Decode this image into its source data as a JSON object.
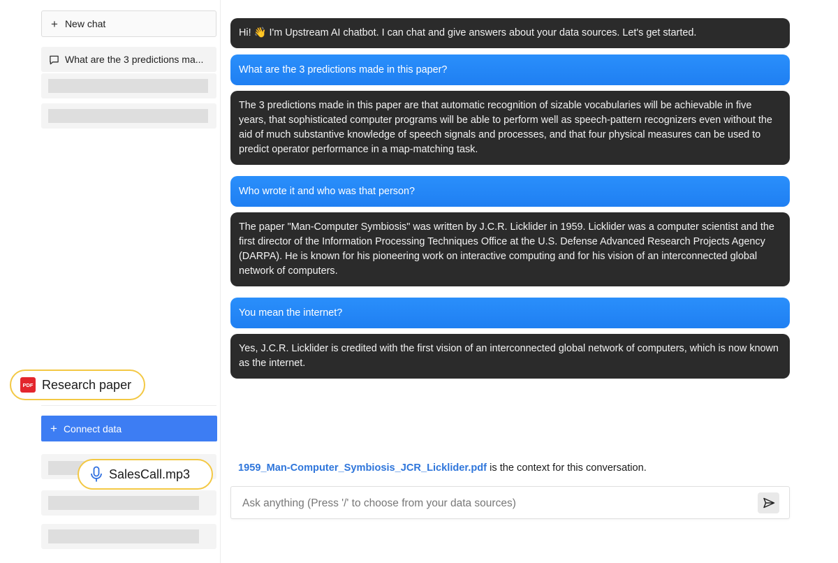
{
  "sidebar": {
    "new_chat_label": "New chat",
    "history": [
      {
        "title": "What are the 3 predictions ma..."
      }
    ],
    "connect_data_label": "Connect data"
  },
  "source_tags": {
    "pdf": {
      "icon": "pdf-icon",
      "icon_text": "PDF",
      "label": "Research paper"
    },
    "audio": {
      "icon": "microphone-icon",
      "label": "SalesCall.mp3"
    }
  },
  "messages": [
    {
      "role": "bot",
      "text": "Hi! 👋 I'm Upstream AI chatbot. I can chat and give answers about your data sources. Let's get started."
    },
    {
      "role": "user",
      "text": "What are the 3 predictions made in this paper?"
    },
    {
      "role": "bot",
      "text": "The 3 predictions made in this paper are that automatic recognition of sizable vocabularies will be achievable in five years, that sophisticated computer programs will be able to perform well as speech-pattern recognizers even without the aid of much substantive knowledge of speech signals and processes, and that four physical measures can be used to predict operator performance in a map-matching task."
    },
    {
      "role": "user",
      "text": "Who wrote it and who was that person?"
    },
    {
      "role": "bot",
      "text": "The paper \"Man-Computer Symbiosis\" was written by J.C.R. Licklider in 1959. Licklider was a computer scientist and the first director of the Information Processing Techniques Office at the U.S. Defense Advanced Research Projects Agency (DARPA). He is known for his pioneering work on interactive computing and for his vision of an interconnected global network of computers."
    },
    {
      "role": "user",
      "text": "You mean the internet?"
    },
    {
      "role": "bot",
      "text": "Yes, J.C.R. Licklider is credited with the first vision of an interconnected global network of computers, which is now known as the internet."
    }
  ],
  "context": {
    "file_name": "1959_Man-Computer_Symbiosis_JCR_Licklider.pdf",
    "suffix": " is the context for this conversation."
  },
  "composer": {
    "placeholder": "Ask anything (Press '/' to choose from your data sources)",
    "send_icon": "send-icon"
  },
  "colors": {
    "accent": "#3d7df3",
    "user_bubble": "#1f85f7",
    "bot_bubble": "#2b2b2b",
    "highlight": "#f3c844",
    "link": "#2f76db"
  }
}
